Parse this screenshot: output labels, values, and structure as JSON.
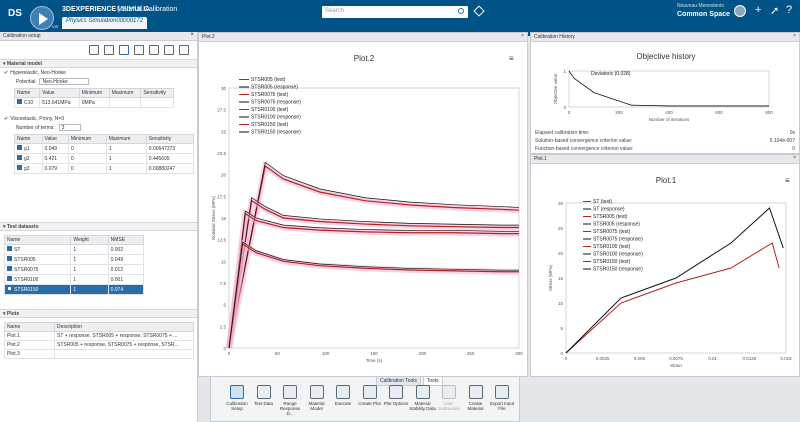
{
  "header": {
    "brand_bold": "3DEXPERIENCE",
    "brand_rest": " | SIMULIA",
    "app_title": "Material Calibration",
    "tab": "Physics Simulation00000172",
    "search_placeholder": "Search",
    "user": "Nouveau Mensolents",
    "space": "Common Space",
    "version": "V.R"
  },
  "left": {
    "panel_title": "Calibration setup",
    "material_title": "Material model",
    "hyper_title": "Hyperelastic, Neo-Hooke",
    "potential_label": "Potential",
    "potential_value": "Neo-Hooke",
    "hyper_cols": [
      "Name",
      "Value",
      "Minimum",
      "Maximum",
      "Sensitivity"
    ],
    "hyper_rows": [
      [
        "C10",
        "513.641MPa",
        "0MPa",
        "",
        ""
      ]
    ],
    "visco_title": "Viscoelastic, Prony, N=3",
    "terms_label": "Number of terms:",
    "terms_value": "3",
    "visco_cols": [
      "Name",
      "Value",
      "Minimum",
      "Maximum",
      "Sensitivity"
    ],
    "visco_rows": [
      [
        "g1",
        "0.049",
        "0",
        "1",
        "0.00647373"
      ],
      [
        "g2",
        "0.421",
        "0",
        "1",
        "0.445605"
      ],
      [
        "g3",
        "0.079",
        "0",
        "1",
        "0.00880247"
      ]
    ],
    "datasets_title": "Test datasets",
    "ds_cols": [
      "Name",
      "Weight",
      "NMSE"
    ],
    "ds_rows": [
      [
        "ST",
        "1",
        "0.002"
      ],
      [
        "STSR005",
        "1",
        "0.049"
      ],
      [
        "STSR0075",
        "1",
        "0.012"
      ],
      [
        "STSR0100",
        "1",
        "0.001"
      ],
      [
        "STSR0150",
        "1",
        "0.074"
      ]
    ],
    "plots_title": "Plots",
    "plots_cols": [
      "Name",
      "Description"
    ],
    "plots_rows": [
      [
        "Plot.1",
        "ST + response, STSR005 + response, STSR0075 + ..."
      ],
      [
        "Plot.2",
        "STSR005 + response, STSR0075 + response, STSR..."
      ],
      [
        "Plot.3",
        ""
      ]
    ]
  },
  "plot2": {
    "tab": "Plot.2",
    "title": "Plot.2",
    "menu": "≡",
    "legend": [
      "STSR005 (test)",
      "STSR005 (response)",
      "STSR0075 (test)",
      "STSR0075 (response)",
      "STSR0100 (test)",
      "STSR0100 (response)",
      "STSR0150 (test)",
      "STSR0150 (response)"
    ],
    "ylabel": "Nominal Stress (MPa)",
    "xlabel": "Time (s)",
    "yticks": [
      "30",
      "27.5",
      "25",
      "22.5",
      "20",
      "17.5",
      "15",
      "12.5",
      "10",
      "7.5",
      "5",
      "2.5",
      "0"
    ],
    "xticks": [
      "0",
      "50",
      "100",
      "150",
      "200",
      "250",
      "300"
    ]
  },
  "history": {
    "tab": "Calibration History",
    "title": "Objective history",
    "legend": "Deviatoric (0.028)",
    "ylabel": "Objective value",
    "xlabel": "Number of iterations",
    "yticks": [
      "1",
      "0"
    ],
    "xticks": [
      "0",
      "200",
      "400",
      "600",
      "800"
    ],
    "kv": [
      [
        "Elapsed calibration time:",
        "0s"
      ],
      [
        "Solution-based convergence criterion value:",
        "6.104e-007"
      ],
      [
        "Function-based convergence criterion value:",
        "0"
      ]
    ]
  },
  "plot1": {
    "tab": "Plot.1",
    "title": "Plot.1",
    "menu": "≡",
    "legend": [
      "ST (test)",
      "ST (response)",
      "STSR005 (test)",
      "STSR005 (response)",
      "STSR0075 (test)",
      "STSR0075 (response)",
      "STSR0100 (test)",
      "STSR0100 (response)",
      "STSR0150 (test)",
      "STSR0150 (response)"
    ],
    "ylabel": "Stress (MPa)",
    "xlabel": "Strain",
    "yticks": [
      "30",
      "25",
      "20",
      "15",
      "10",
      "5",
      "0"
    ],
    "xticks": [
      "0",
      "0.0025",
      "0.005",
      "0.0075",
      "0.01",
      "0.0125",
      "0.015"
    ]
  },
  "bottom": {
    "tabs": [
      "Calibration Tools",
      "Tools"
    ],
    "tools": [
      "Calibration Setup",
      "Test Data",
      "Range Response D...",
      "Material Model",
      "Execute",
      "Create Plot",
      "Plot Options",
      "Material Stability Data",
      "User Subroutine",
      "Create Material",
      "Export Input File"
    ]
  },
  "chart_data": [
    {
      "type": "line",
      "title": "Plot.2",
      "xlabel": "Time (s)",
      "ylabel": "Nominal Stress (MPa)",
      "xlim": [
        0,
        320
      ],
      "ylim": [
        0,
        30
      ],
      "series": [
        {
          "name": "STSR005 (test)",
          "x": [
            0,
            40,
            60,
            100,
            150,
            200,
            250,
            300,
            320
          ],
          "y": [
            0,
            21,
            19.5,
            18,
            17,
            16.5,
            16.2,
            16,
            15.9
          ]
        },
        {
          "name": "STSR0075 (test)",
          "x": [
            0,
            25,
            40,
            60,
            100,
            150,
            200,
            250,
            300,
            320
          ],
          "y": [
            0,
            17,
            16,
            15,
            14.6,
            14.3,
            14.1,
            14,
            13.9,
            13.9
          ]
        },
        {
          "name": "STSR0100 (test)",
          "x": [
            0,
            18,
            30,
            60,
            100,
            150,
            200,
            250,
            300,
            320
          ],
          "y": [
            0,
            15.5,
            14.7,
            13.9,
            13.6,
            13.4,
            13.3,
            13.3,
            13.2,
            13.2
          ]
        },
        {
          "name": "STSR0150 (test)",
          "x": [
            0,
            15,
            30,
            60,
            100,
            150,
            200,
            250,
            300,
            320
          ],
          "y": [
            0,
            12,
            11,
            10,
            9.5,
            9.2,
            9,
            8.9,
            8.8,
            8.8
          ]
        }
      ]
    },
    {
      "type": "line",
      "title": "Objective history",
      "xlabel": "Number of iterations",
      "ylabel": "Objective value",
      "xlim": [
        0,
        800
      ],
      "ylim": [
        0,
        1
      ],
      "series": [
        {
          "name": "Deviatoric (0.028)",
          "x": [
            0,
            20,
            100,
            250,
            400,
            800
          ],
          "y": [
            1,
            0.8,
            0.4,
            0.05,
            0.03,
            0.03
          ]
        }
      ]
    },
    {
      "type": "line",
      "title": "Plot.1",
      "xlabel": "Strain",
      "ylabel": "Stress (MPa)",
      "xlim": [
        0,
        0.016
      ],
      "ylim": [
        0,
        30
      ],
      "series": [
        {
          "name": "ST (test)",
          "x": [
            0,
            0.004,
            0.008,
            0.012,
            0.015,
            0.0155
          ],
          "y": [
            0,
            10,
            14,
            17,
            22,
            17
          ]
        },
        {
          "name": "ST (response)",
          "x": [
            0,
            0.004,
            0.008,
            0.012,
            0.0148,
            0.0158
          ],
          "y": [
            0,
            11,
            15,
            22,
            29,
            21
          ]
        }
      ]
    }
  ]
}
